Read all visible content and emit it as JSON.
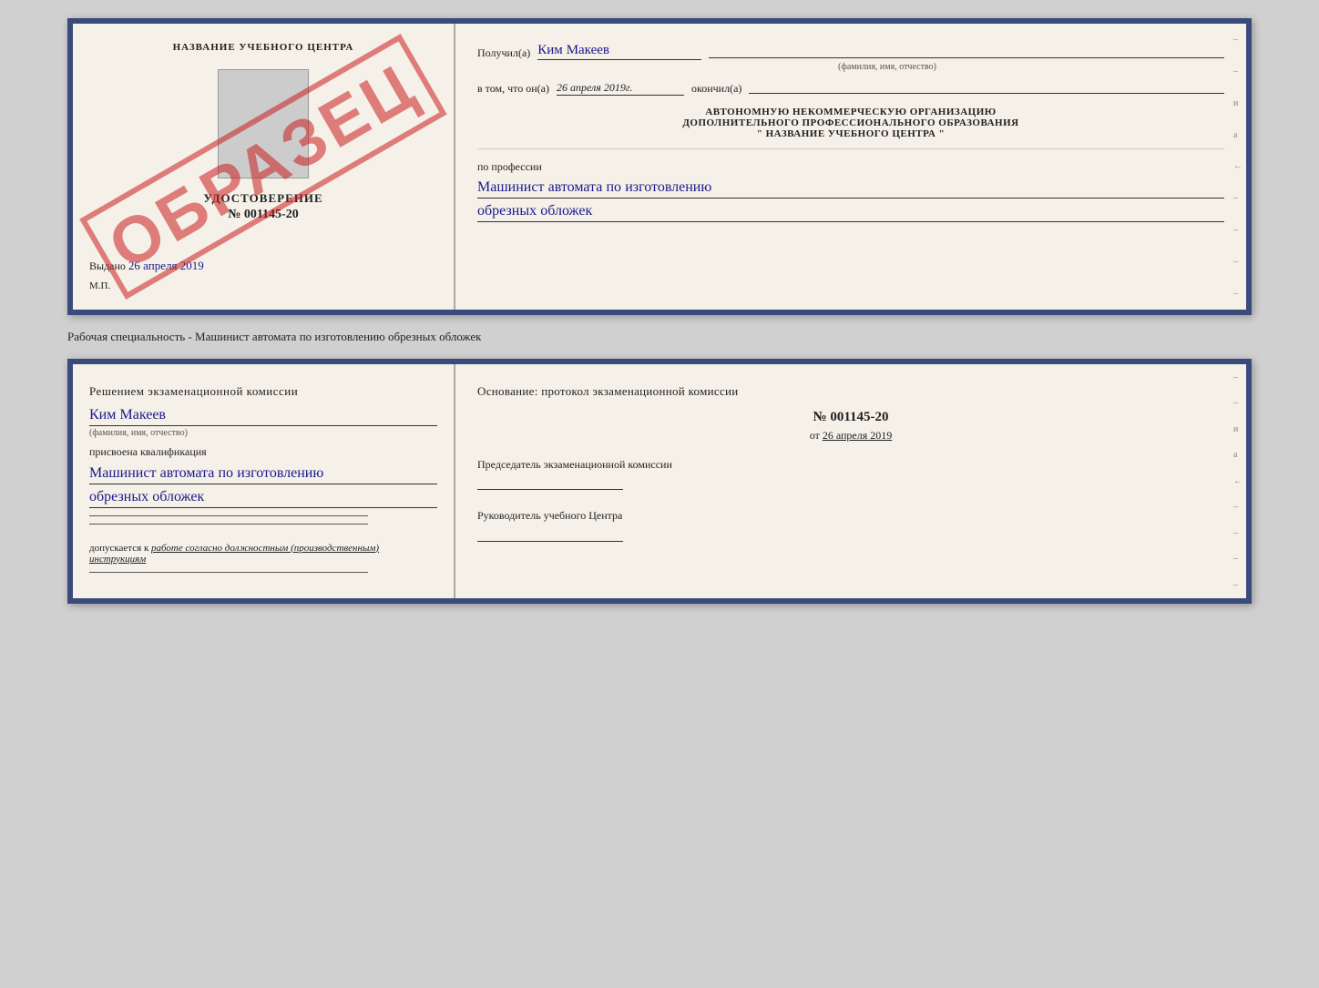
{
  "top_card": {
    "left": {
      "org_name": "НАЗВАНИЕ УЧЕБНОГО ЦЕНТРА",
      "cert_title": "УДОСТОВЕРЕНИЕ",
      "cert_number": "№ 001145-20",
      "issued_label": "Выдано",
      "issued_date": "26 апреля 2019",
      "mp_label": "М.П.",
      "watermark": "ОБРАЗЕЦ"
    },
    "right": {
      "received_label": "Получил(а)",
      "recipient_name": "Ким Макеев",
      "fio_label": "(фамилия, имя, отчество)",
      "in_that_label": "в том, что он(а)",
      "completion_date": "26 апреля 2019г.",
      "finished_label": "окончил(а)",
      "org_line1": "АВТОНОМНУЮ НЕКОММЕРЧЕСКУЮ ОРГАНИЗАЦИЮ",
      "org_line2": "ДОПОЛНИТЕЛЬНОГО ПРОФЕССИОНАЛЬНОГО ОБРАЗОВАНИЯ",
      "org_line3": "\"   НАЗВАНИЕ УЧЕБНОГО ЦЕНТРА   \"",
      "profession_label": "по профессии",
      "profession_line1": "Машинист автомата по изготовлению",
      "profession_line2": "обрезных обложек"
    }
  },
  "caption": {
    "text": "Рабочая специальность - Машинист автомата по изготовлению обрезных обложек"
  },
  "bottom_card": {
    "left": {
      "decision_label": "Решением экзаменационной комиссии",
      "person_name": "Ким Макеев",
      "fio_label": "(фамилия, имя, отчество)",
      "assigned_label": "присвоена квалификация",
      "qualification_line1": "Машинист автомата по изготовлению",
      "qualification_line2": "обрезных обложек",
      "allowed_prefix": "допускается к",
      "allowed_text": "работе согласно должностным (производственным) инструкциям"
    },
    "right": {
      "basis_label": "Основание: протокол экзаменационной комиссии",
      "protocol_number": "№  001145-20",
      "date_prefix": "от",
      "protocol_date": "26 апреля 2019",
      "chairman_label": "Председатель экзаменационной комиссии",
      "director_label": "Руководитель учебного Центра"
    }
  }
}
